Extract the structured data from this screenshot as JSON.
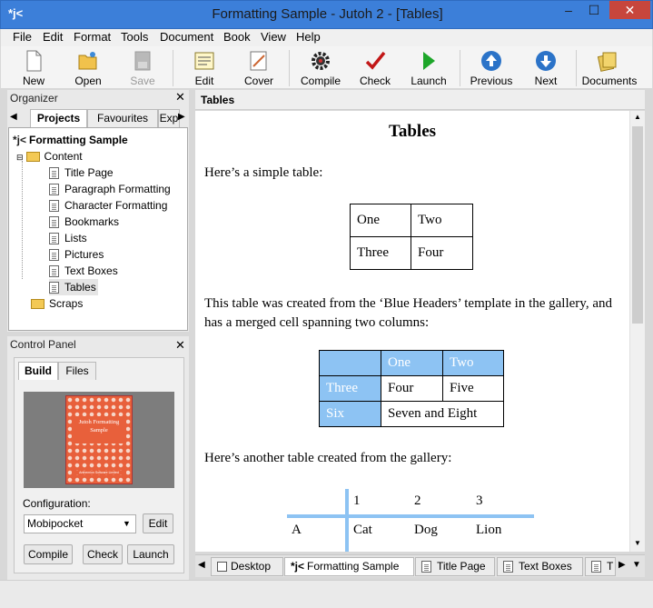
{
  "window": {
    "title": "Formatting Sample - Jutoh 2 - [Tables]",
    "min": "–",
    "max": "☐",
    "close": "✕",
    "logo": "*j<"
  },
  "menu": [
    "File",
    "Edit",
    "Format",
    "Tools",
    "Document",
    "Book",
    "View",
    "Help"
  ],
  "toolbar": {
    "new": "New",
    "open": "Open",
    "save": "Save",
    "edit": "Edit",
    "cover": "Cover",
    "compile": "Compile",
    "check": "Check",
    "launch": "Launch",
    "previous": "Previous",
    "next": "Next",
    "documents": "Documents"
  },
  "organizer": {
    "title": "Organizer",
    "tabs": [
      "Projects",
      "Favourites",
      "Exp"
    ],
    "project": "Formatting Sample",
    "content": "Content",
    "items": [
      "Title Page",
      "Paragraph Formatting",
      "Character Formatting",
      "Bookmarks",
      "Lists",
      "Pictures",
      "Text Boxes",
      "Tables"
    ],
    "scraps": "Scraps"
  },
  "control_panel": {
    "title": "Control Panel",
    "tabs": [
      "Build",
      "Files"
    ],
    "cover_title": "Jutoh Formatting Sample",
    "cover_publisher": "Anthemion Software Limited",
    "config_label": "Configuration:",
    "config_value": "Mobipocket",
    "edit_btn": "Edit",
    "compile_btn": "Compile",
    "check_btn": "Check",
    "launch_btn": "Launch"
  },
  "document": {
    "header": "Tables",
    "heading": "Tables",
    "para1": "Here’s a simple table:",
    "table1": [
      [
        "One",
        "Two"
      ],
      [
        "Three",
        "Four"
      ]
    ],
    "para2": "This table was created from the ‘Blue Headers’ template in the gallery, and has a merged cell spanning two columns:",
    "table2": {
      "header": [
        "",
        "One",
        "Two"
      ],
      "row1": [
        "Three",
        "Four",
        "Five"
      ],
      "row2": [
        "Six",
        "Seven and Eight"
      ]
    },
    "para3": "Here’s another table created from the gallery:",
    "table3": {
      "header": [
        "",
        "1",
        "2",
        "3"
      ],
      "row1": [
        "A",
        "Cat",
        "Dog",
        "Lion"
      ]
    }
  },
  "bottom_tabs": [
    "Desktop",
    "Formatting Sample",
    "Title Page",
    "Text Boxes",
    "T"
  ],
  "colors": {
    "titlebar": "#3c7fd9",
    "table_header": "#8dc3f3",
    "close": "#c7463c"
  }
}
